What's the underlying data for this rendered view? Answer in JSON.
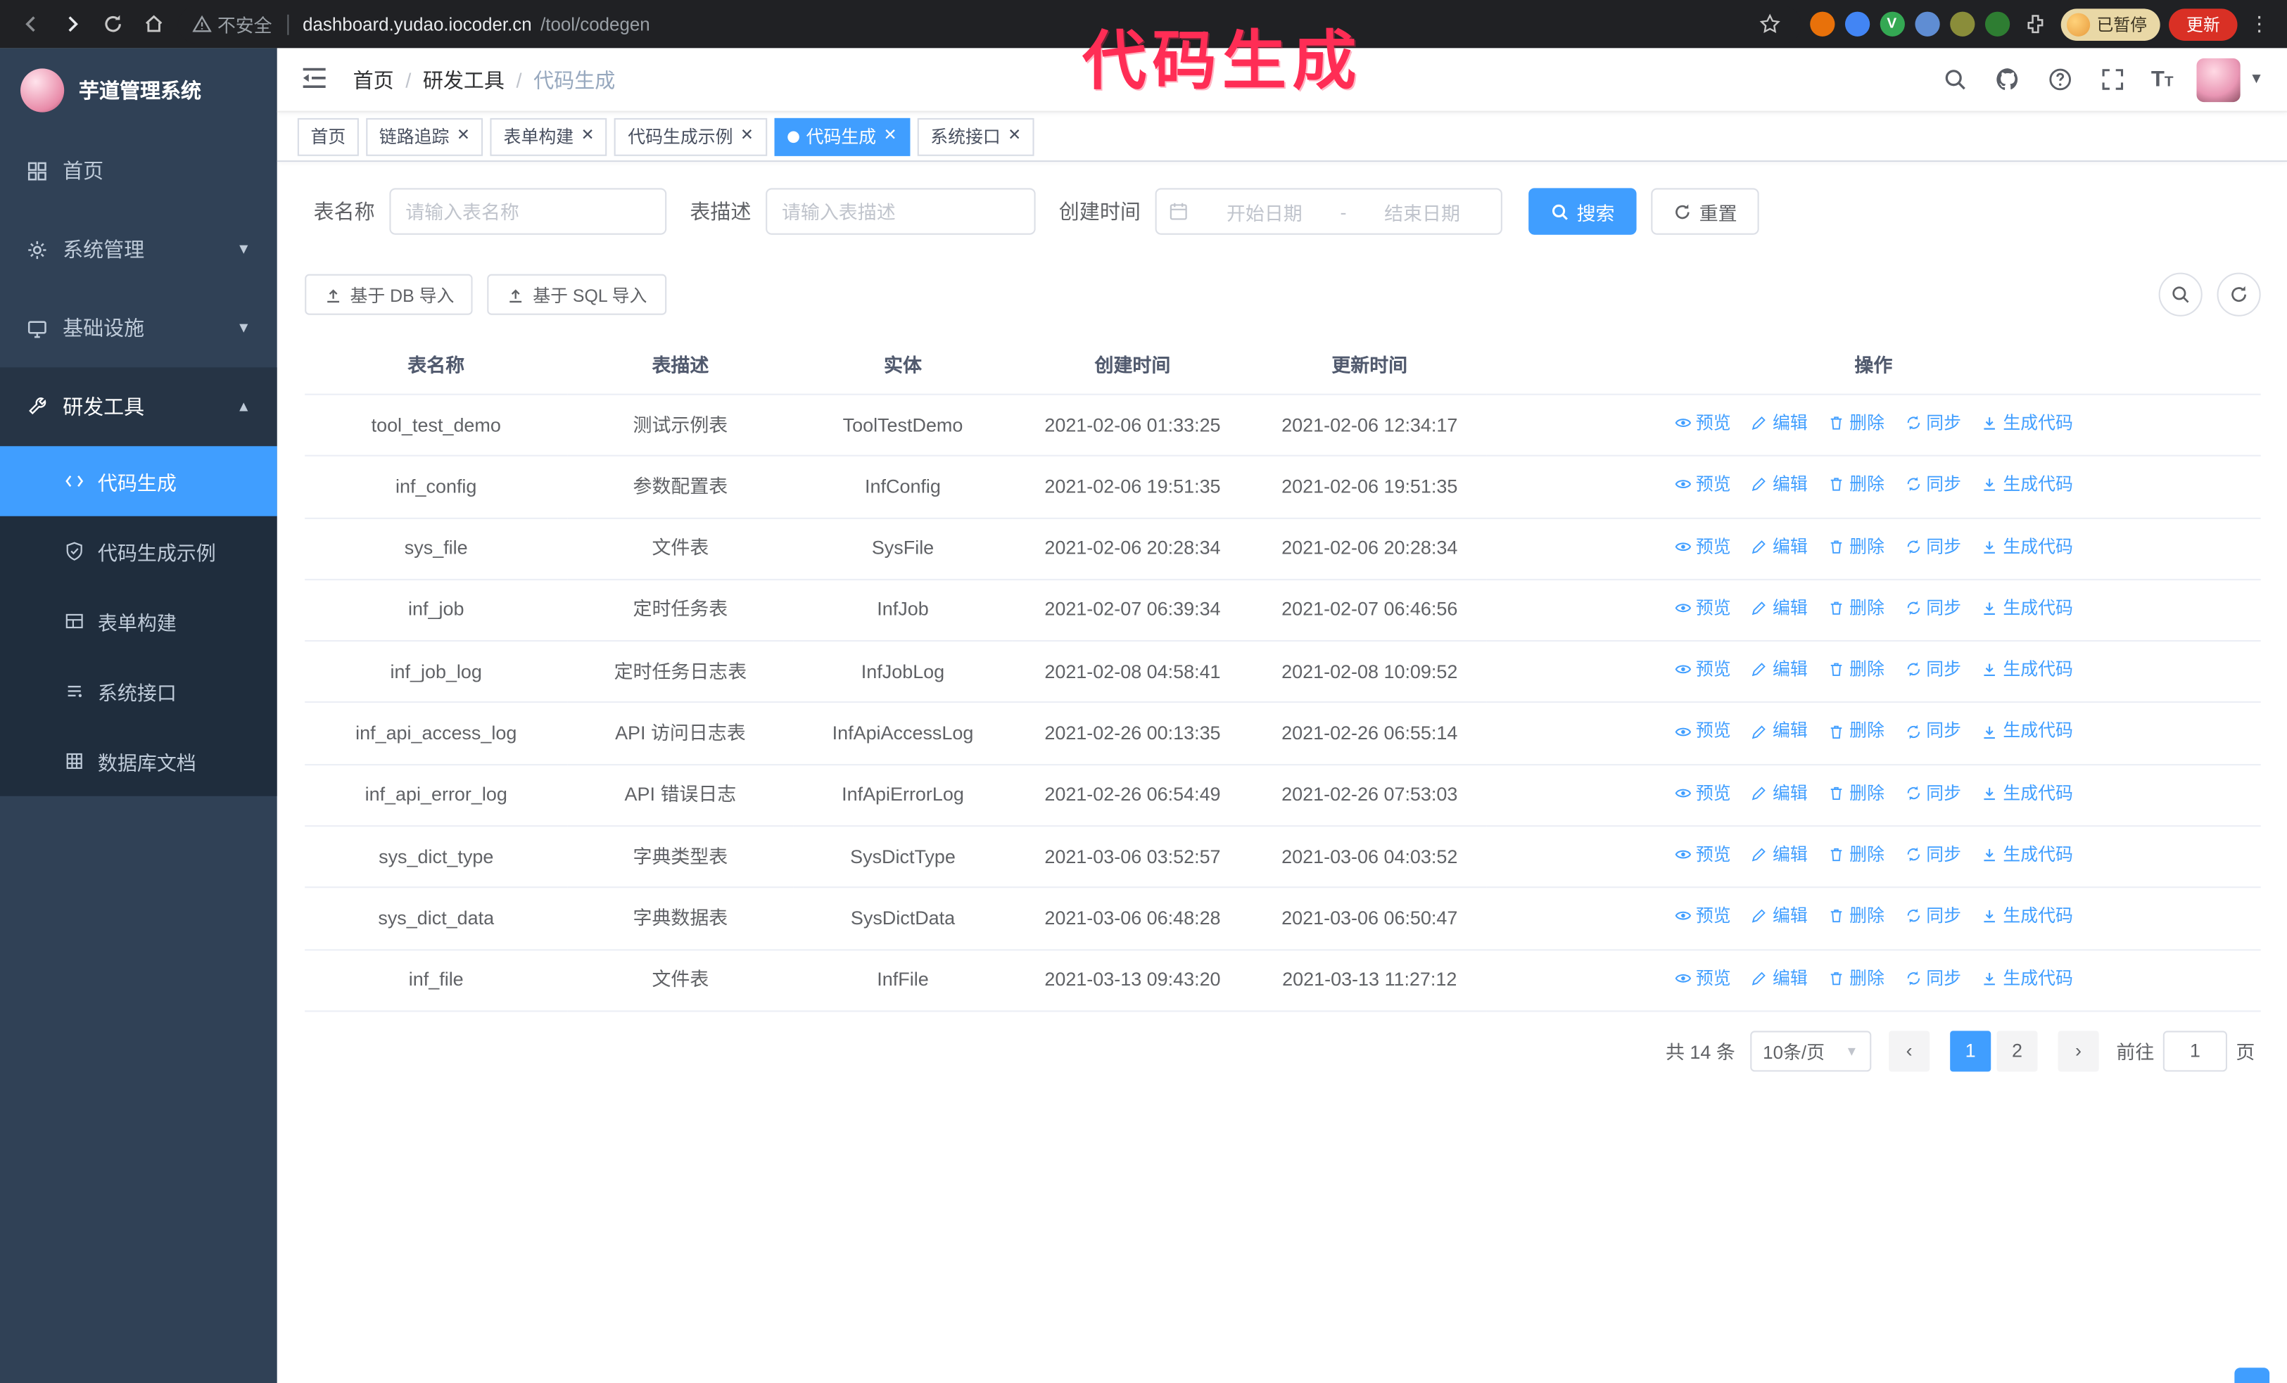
{
  "annotation": {
    "text": "代码生成",
    "color": "#ff2d55"
  },
  "browser": {
    "security_label": "不安全",
    "url_domain": "dashboard.yudao.iocoder.cn",
    "url_path": "/tool/codegen",
    "paused_badge": "已暂停",
    "update_button": "更新"
  },
  "sidebar": {
    "logo_title": "芋道管理系统",
    "items": [
      {
        "label": "首页"
      },
      {
        "label": "系统管理"
      },
      {
        "label": "基础设施"
      },
      {
        "label": "研发工具"
      }
    ],
    "submenu": [
      {
        "label": "代码生成",
        "active": true
      },
      {
        "label": "代码生成示例"
      },
      {
        "label": "表单构建"
      },
      {
        "label": "系统接口"
      },
      {
        "label": "数据库文档"
      }
    ]
  },
  "header": {
    "breadcrumb": {
      "home": "首页",
      "parent": "研发工具",
      "current": "代码生成"
    }
  },
  "tabs": [
    {
      "label": "首页"
    },
    {
      "label": "链路追踪"
    },
    {
      "label": "表单构建"
    },
    {
      "label": "代码生成示例"
    },
    {
      "label": "代码生成",
      "active": true
    },
    {
      "label": "系统接口"
    }
  ],
  "filters": {
    "table_name_label": "表名称",
    "table_name_placeholder": "请输入表名称",
    "table_desc_label": "表描述",
    "table_desc_placeholder": "请输入表描述",
    "create_time_label": "创建时间",
    "date_start_placeholder": "开始日期",
    "date_separator": "-",
    "date_end_placeholder": "结束日期",
    "search_button": "搜索",
    "reset_button": "重置"
  },
  "toolbar": {
    "import_db": "基于 DB 导入",
    "import_sql": "基于 SQL 导入"
  },
  "table": {
    "columns": [
      "表名称",
      "表描述",
      "实体",
      "创建时间",
      "更新时间",
      "操作"
    ],
    "actions": [
      "预览",
      "编辑",
      "删除",
      "同步",
      "生成代码"
    ],
    "rows": [
      [
        "tool_test_demo",
        "测试示例表",
        "ToolTestDemo",
        "2021-02-06 01:33:25",
        "2021-02-06 12:34:17"
      ],
      [
        "inf_config",
        "参数配置表",
        "InfConfig",
        "2021-02-06 19:51:35",
        "2021-02-06 19:51:35"
      ],
      [
        "sys_file",
        "文件表",
        "SysFile",
        "2021-02-06 20:28:34",
        "2021-02-06 20:28:34"
      ],
      [
        "inf_job",
        "定时任务表",
        "InfJob",
        "2021-02-07 06:39:34",
        "2021-02-07 06:46:56"
      ],
      [
        "inf_job_log",
        "定时任务日志表",
        "InfJobLog",
        "2021-02-08 04:58:41",
        "2021-02-08 10:09:52"
      ],
      [
        "inf_api_access_log",
        "API 访问日志表",
        "InfApiAccessLog",
        "2021-02-26 00:13:35",
        "2021-02-26 06:55:14"
      ],
      [
        "inf_api_error_log",
        "API 错误日志",
        "InfApiErrorLog",
        "2021-02-26 06:54:49",
        "2021-02-26 07:53:03"
      ],
      [
        "sys_dict_type",
        "字典类型表",
        "SysDictType",
        "2021-03-06 03:52:57",
        "2021-03-06 04:03:52"
      ],
      [
        "sys_dict_data",
        "字典数据表",
        "SysDictData",
        "2021-03-06 06:48:28",
        "2021-03-06 06:50:47"
      ],
      [
        "inf_file",
        "文件表",
        "InfFile",
        "2021-03-13 09:43:20",
        "2021-03-13 11:27:12"
      ]
    ]
  },
  "pagination": {
    "total": "共 14 条",
    "page_size": "10条/页",
    "pages": [
      "1",
      "2"
    ],
    "active_page": "1",
    "goto_label": "前往",
    "goto_value": "1",
    "goto_suffix": "页"
  }
}
